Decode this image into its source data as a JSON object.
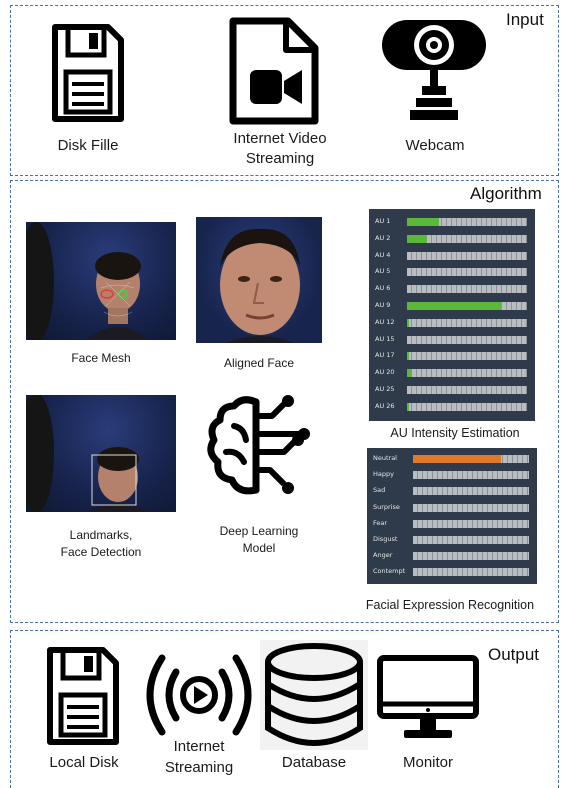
{
  "sections": {
    "input": {
      "title": "Input"
    },
    "algorithm": {
      "title": "Algorithm"
    },
    "output": {
      "title": "Output"
    }
  },
  "input_items": {
    "disk": "Disk Fille",
    "video_line1": "Internet Video",
    "video_line2": "Streaming",
    "webcam": "Webcam"
  },
  "algorithm_items": {
    "face_mesh": "Face Mesh",
    "aligned_face": "Aligned Face",
    "landmarks_line1": "Landmarks,",
    "landmarks_line2": "Face Detection",
    "dl_line1": "Deep Learning",
    "dl_line2": "Model",
    "au_caption": "AU Intensity Estimation",
    "fer_caption": "Facial Expression Recognition"
  },
  "output_items": {
    "local_disk": "Local Disk",
    "streaming_line1": "Internet",
    "streaming_line2": "Streaming",
    "database": "Database",
    "monitor": "Monitor"
  },
  "au_bars": [
    {
      "label": "AU 1",
      "value": 0.27,
      "color": "#5cb83a"
    },
    {
      "label": "AU 2",
      "value": 0.17,
      "color": "#5cb83a"
    },
    {
      "label": "AU 4",
      "value": 0.0,
      "color": "#5cb83a"
    },
    {
      "label": "AU 5",
      "value": 0.0,
      "color": "#5cb83a"
    },
    {
      "label": "AU 6",
      "value": 0.0,
      "color": "#5cb83a"
    },
    {
      "label": "AU 9",
      "value": 0.78,
      "color": "#5cb83a"
    },
    {
      "label": "AU 12",
      "value": 0.02,
      "color": "#5cb83a"
    },
    {
      "label": "AU 15",
      "value": 0.0,
      "color": "#5cb83a"
    },
    {
      "label": "AU 17",
      "value": 0.02,
      "color": "#5cb83a"
    },
    {
      "label": "AU 20",
      "value": 0.03,
      "color": "#5cb83a"
    },
    {
      "label": "AU 25",
      "value": 0.0,
      "color": "#5cb83a"
    },
    {
      "label": "AU 26",
      "value": 0.02,
      "color": "#5cb83a"
    }
  ],
  "expression_bars": [
    {
      "label": "Neutral",
      "value": 0.76,
      "color": "#e07a2a"
    },
    {
      "label": "Happy",
      "value": 0.0,
      "color": "#e07a2a"
    },
    {
      "label": "Sad",
      "value": 0.0,
      "color": "#e07a2a"
    },
    {
      "label": "Surprise",
      "value": 0.0,
      "color": "#e07a2a"
    },
    {
      "label": "Fear",
      "value": 0.0,
      "color": "#e07a2a"
    },
    {
      "label": "Disgust",
      "value": 0.0,
      "color": "#e07a2a"
    },
    {
      "label": "Anger",
      "value": 0.0,
      "color": "#e07a2a"
    },
    {
      "label": "Contempt",
      "value": 0.0,
      "color": "#e07a2a"
    }
  ],
  "colors": {
    "section_border": "#4a6ea9",
    "panel_bg": "#2f3a4a",
    "photo_bg": "#18213a"
  }
}
